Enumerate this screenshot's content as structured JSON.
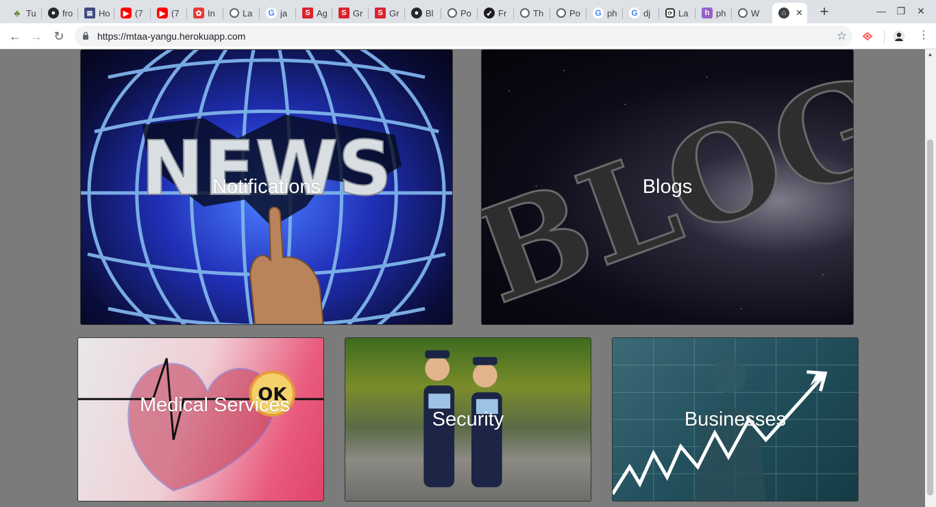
{
  "browser": {
    "tabs": [
      {
        "title": "Tu",
        "icon": "tree-icon"
      },
      {
        "title": "fro",
        "icon": "github-icon"
      },
      {
        "title": "Ho",
        "icon": "hackerrank-icon"
      },
      {
        "title": "(7",
        "icon": "youtube-icon"
      },
      {
        "title": "(7",
        "icon": "youtube-icon"
      },
      {
        "title": "In",
        "icon": "instagram-like-icon"
      },
      {
        "title": "La",
        "icon": "globe-icon"
      },
      {
        "title": "ja",
        "icon": "google-icon"
      },
      {
        "title": "Ag",
        "icon": "s-icon"
      },
      {
        "title": "Gr",
        "icon": "s-icon"
      },
      {
        "title": "Gr",
        "icon": "s-icon"
      },
      {
        "title": "Bl",
        "icon": "github-icon"
      },
      {
        "title": "Po",
        "icon": "globe-icon"
      },
      {
        "title": "Fr",
        "icon": "feather-icon"
      },
      {
        "title": "Th",
        "icon": "globe-icon"
      },
      {
        "title": "Po",
        "icon": "globe-icon"
      },
      {
        "title": "ph",
        "icon": "google-icon"
      },
      {
        "title": "dj",
        "icon": "google-icon"
      },
      {
        "title": "La",
        "icon": "lastpass-icon"
      },
      {
        "title": "ph",
        "icon": "heroku-icon"
      },
      {
        "title": "W",
        "icon": "globe-icon"
      },
      {
        "title": "",
        "icon": "home-icon",
        "active": true
      }
    ],
    "url": "https://mtaa-yangu.herokuapp.com"
  },
  "cards": {
    "notifications": "Notifications",
    "blogs": "Blogs",
    "medical": "Medical Services",
    "security": "Security",
    "businesses": "Businesses"
  },
  "imagery": {
    "news_word": "NEWS",
    "blog_word": "BLOG",
    "ok_word": "OK"
  }
}
